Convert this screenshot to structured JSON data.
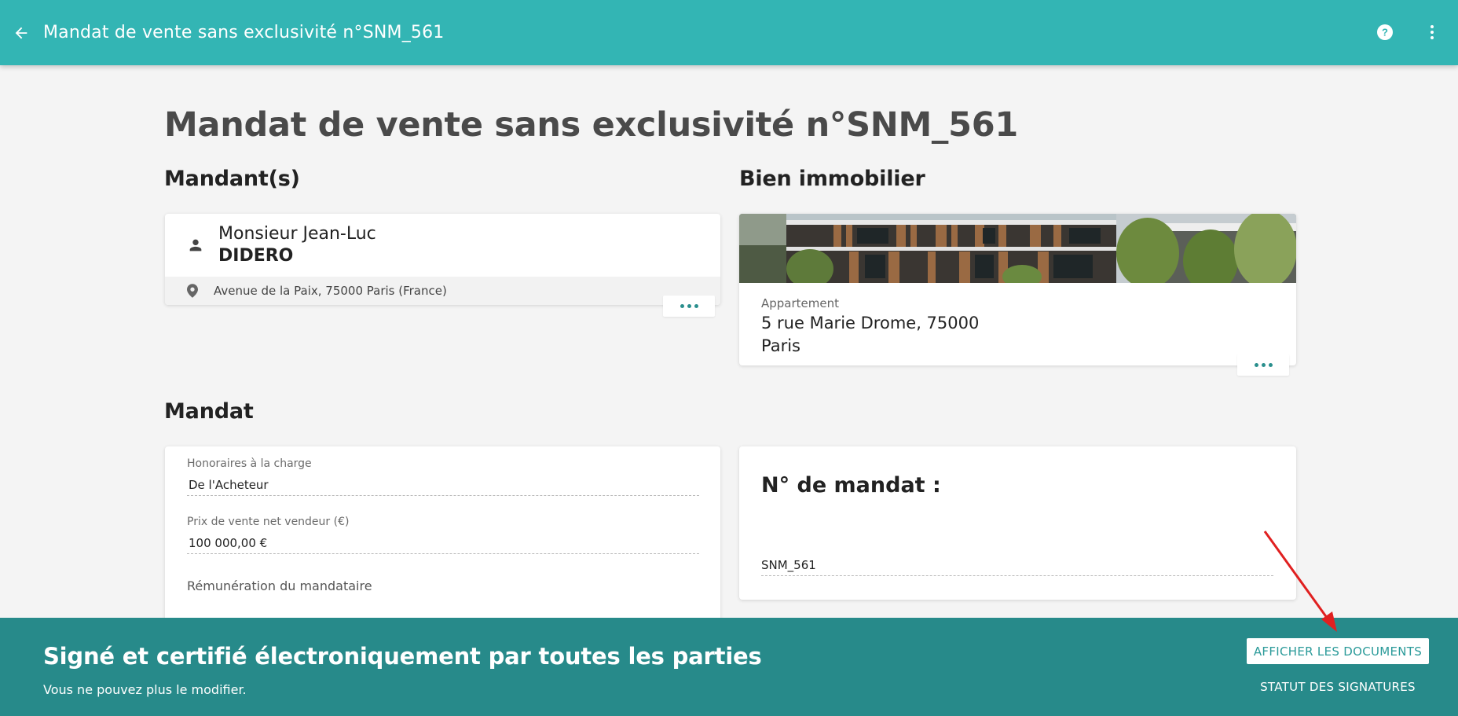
{
  "appbar": {
    "title": "Mandat de vente sans exclusivité n°SNM_561",
    "back_icon": "arrow-left-icon",
    "help_icon": "help-circle-icon",
    "menu_icon": "more-vert-icon"
  },
  "page": {
    "title": "Mandat de vente sans exclusivité n°SNM_561"
  },
  "mandants": {
    "heading": "Mandant(s)",
    "person": {
      "first_line": "Monsieur Jean-Luc",
      "last_name": "DIDERO",
      "address": "Avenue de la Paix, 75000 Paris (France)"
    }
  },
  "bien": {
    "heading": "Bien immobilier",
    "type": "Appartement",
    "address": "5 rue Marie Drome, 75000 Paris"
  },
  "mandat": {
    "heading": "Mandat",
    "honoraires_label": "Honoraires à la charge",
    "honoraires_value": "De l'Acheteur",
    "prix_label": "Prix de vente net vendeur (€)",
    "prix_value": "100 000,00 €",
    "remuneration_label": "Rémunération du mandataire",
    "numero_title": "N° de mandat :",
    "numero_value": "SNM_561"
  },
  "banner": {
    "title": "Signé et certifié électroniquement par toutes les parties",
    "subtitle": "Vous ne pouvez plus le modifier.",
    "docs_button": "AFFICHER LES DOCUMENTS",
    "status_button": "STATUT DES SIGNATURES"
  },
  "colors": {
    "appbar": "#33b5b4",
    "banner": "#278a8a",
    "accent": "#2a9a99",
    "arrow": "#e02020"
  }
}
